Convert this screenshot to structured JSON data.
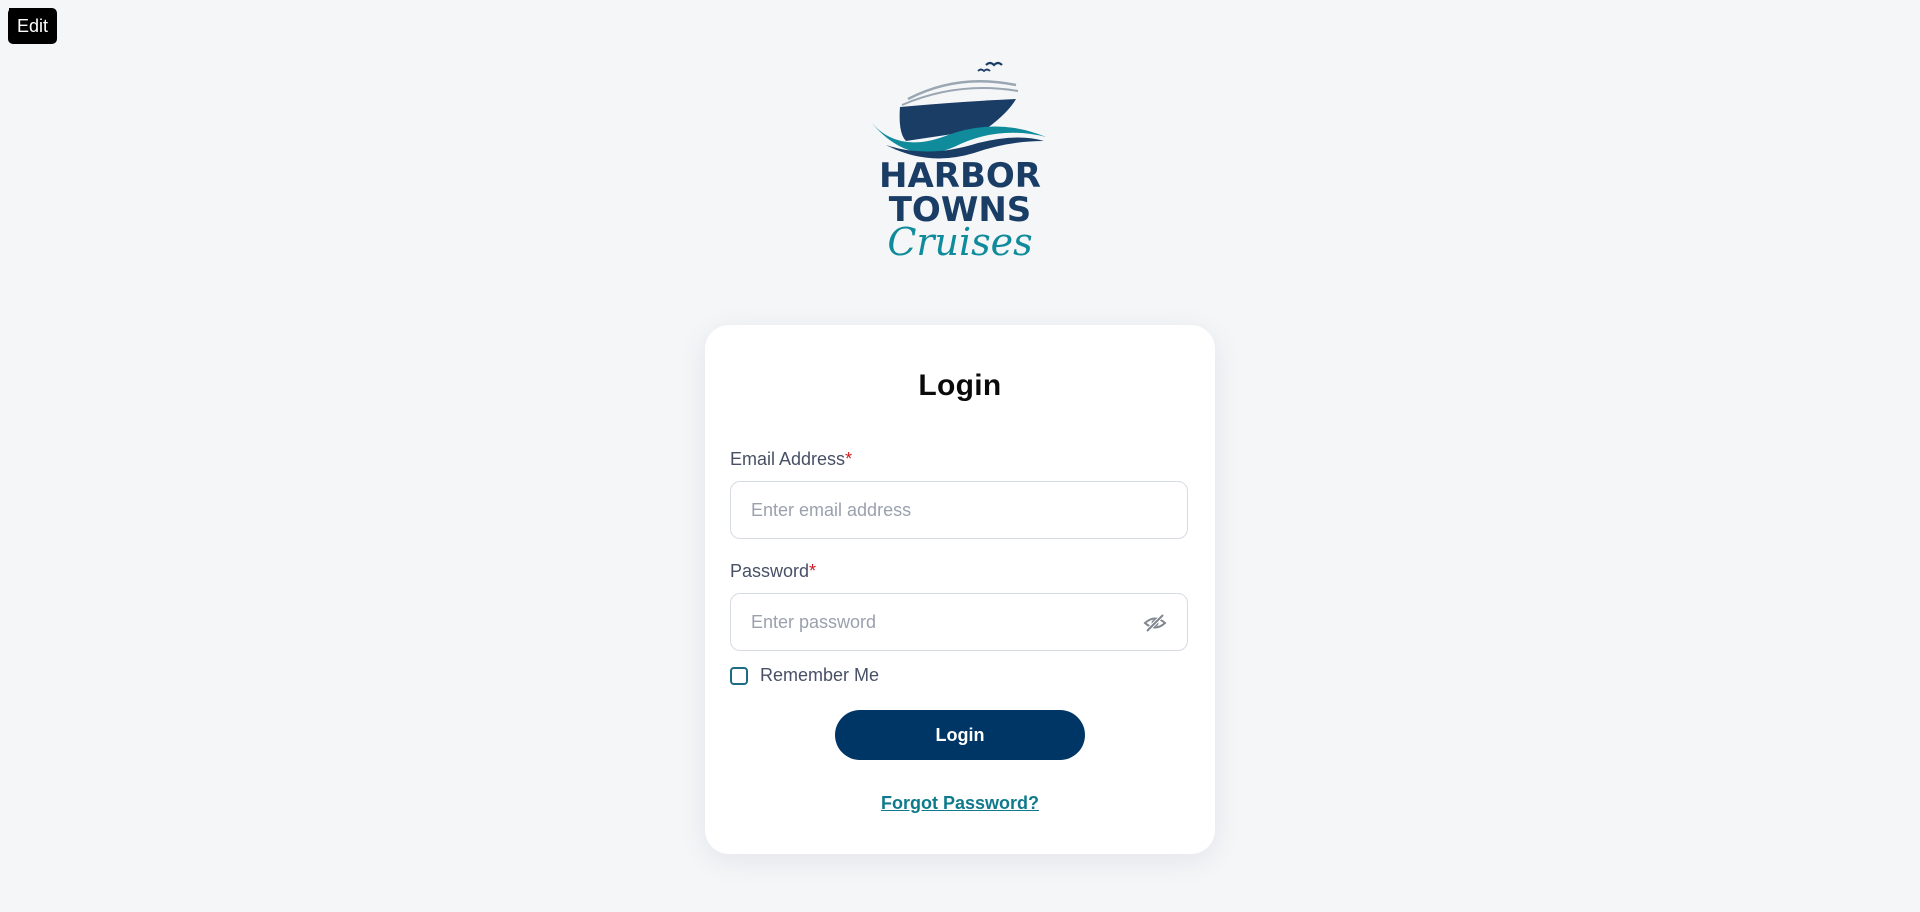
{
  "tooltip": {
    "label": "Edit"
  },
  "logo": {
    "line1": "HARBOR",
    "line2": "TOWNS",
    "line3": "Cruises",
    "colors": {
      "navy": "#1a3d66",
      "teal": "#0f8b9b",
      "gray": "#9ba6b3"
    }
  },
  "login_form": {
    "title": "Login",
    "email_label": "Email Address",
    "email_required_mark": "*",
    "email_placeholder": "Enter email address",
    "email_value": "",
    "password_label": "Password",
    "password_required_mark": "*",
    "password_placeholder": "Enter password",
    "password_value": "",
    "password_toggle_icon": "eye-slash-icon",
    "remember_label": "Remember Me",
    "remember_checked": false,
    "submit_label": "Login",
    "forgot_label": "Forgot Password?"
  },
  "colors": {
    "background": "#f5f6f8",
    "card": "#ffffff",
    "primary": "#003666",
    "link": "#0f7a8c",
    "required": "#d0191f"
  }
}
